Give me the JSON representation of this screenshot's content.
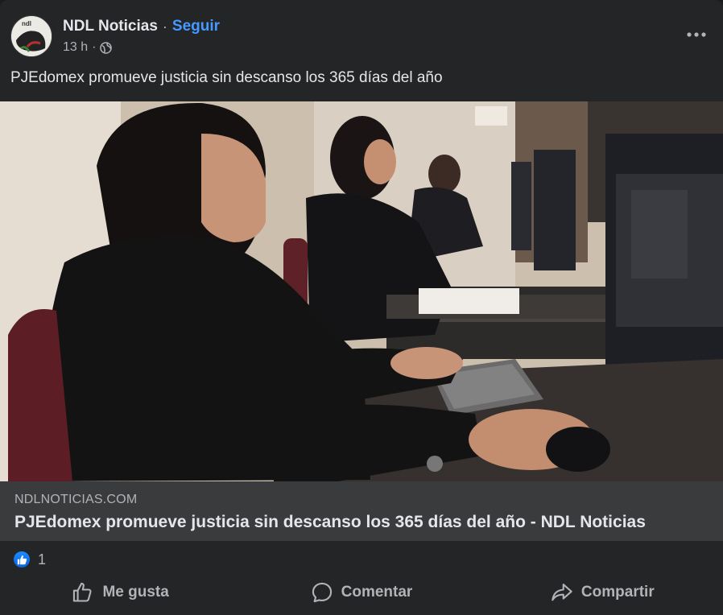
{
  "post": {
    "page_name": "NDL Noticias",
    "follow_label": "Seguir",
    "time": "13 h",
    "text": "PJEdomex promueve justicia sin descanso los 365 días del año",
    "avatar_text": "ndl"
  },
  "link_preview": {
    "domain": "NDLNOTICIAS.COM",
    "title": "PJEdomex promueve justicia sin descanso los 365 días del año - NDL Noticias"
  },
  "reactions": {
    "count": "1"
  },
  "actions": {
    "like": "Me gusta",
    "comment": "Comentar",
    "share": "Compartir"
  },
  "colors": {
    "background": "#242526",
    "link_box": "#3a3b3c",
    "accent": "#4599ff",
    "secondary_text": "#b0b3b8"
  },
  "icons": [
    "globe-icon",
    "more-options-icon",
    "like-reaction-icon",
    "thumbs-up-icon",
    "comment-icon",
    "share-icon"
  ]
}
